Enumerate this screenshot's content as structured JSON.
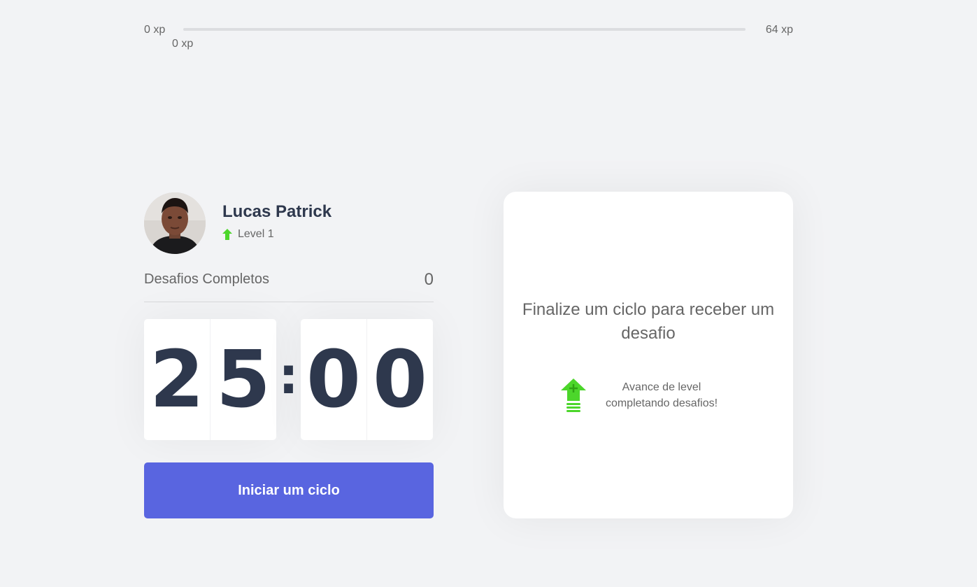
{
  "xp": {
    "min_label": "0 xp",
    "max_label": "64 xp",
    "current_label": "0 xp",
    "progress_fraction": 0
  },
  "profile": {
    "name": "Lucas Patrick",
    "level_label": "Level 1",
    "level_icon": "level-up-arrow-icon"
  },
  "completed": {
    "label": "Desafios Completos",
    "count": "0"
  },
  "countdown": {
    "minute_left": "2",
    "minute_right": "5",
    "separator": ":",
    "second_left": "0",
    "second_right": "0"
  },
  "start_button": {
    "label": "Iniciar um ciclo"
  },
  "challenge": {
    "title": "Finalize um ciclo para receber um desafio",
    "hint_line1": "Avance de level",
    "hint_line2": "completando desafios!",
    "hint_icon": "level-up-icon"
  },
  "colors": {
    "background": "#f2f3f5",
    "accent_blue": "#5965e0",
    "green": "#4cd62b",
    "title": "#2e384d",
    "text": "#666666",
    "card": "#ffffff"
  }
}
